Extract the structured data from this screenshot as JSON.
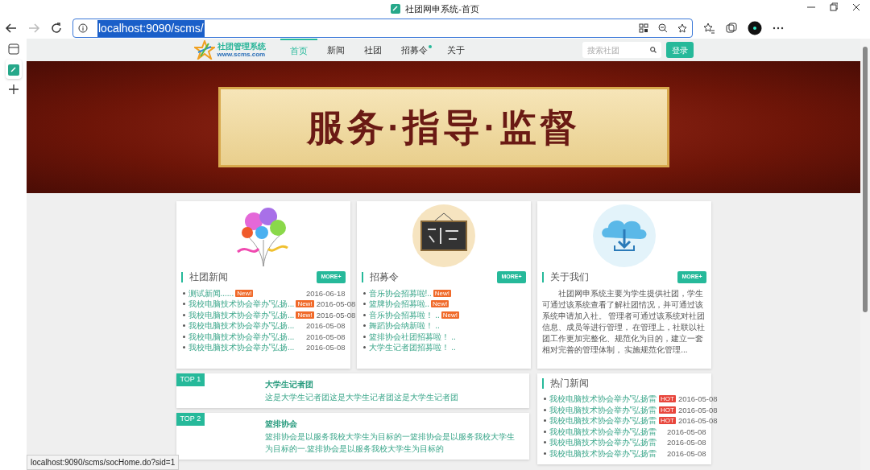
{
  "browser": {
    "tab_title": "社团网申系统-首页",
    "url": "localhost:9090/scms/",
    "status_url": "localhost:9090/scms/socHome.do?sid=1"
  },
  "site": {
    "logo_title": "社团管理系统",
    "logo_subtitle": "www.scms.com",
    "nav": [
      {
        "label": "首页",
        "selected": true,
        "dot": false
      },
      {
        "label": "新闻",
        "selected": false,
        "dot": false
      },
      {
        "label": "社团",
        "selected": false,
        "dot": false
      },
      {
        "label": "招募令",
        "selected": false,
        "dot": true
      },
      {
        "label": "关于",
        "selected": false,
        "dot": false
      }
    ],
    "search": {
      "placeholder": "搜索社团"
    },
    "login": "登录"
  },
  "banner": {
    "title": "服务·指导·监督"
  },
  "panels": [
    {
      "kind": "news",
      "title": "社团新闻",
      "more": "MORE+",
      "items": [
        {
          "text": "测试新闻......",
          "badge": "New!",
          "date": "2016-06-18"
        },
        {
          "text": "我校电脑技术协会举办\"弘扬...",
          "badge": "New!",
          "date": "2016-05-08"
        },
        {
          "text": "我校电脑技术协会举办\"弘扬...",
          "badge": "New!",
          "date": "2016-05-08"
        },
        {
          "text": "我校电脑技术协会举办\"弘扬...",
          "date": "2016-05-08"
        },
        {
          "text": "我校电脑技术协会举办\"弘扬...",
          "date": "2016-05-08"
        },
        {
          "text": "我校电脑技术协会举办\"弘扬...",
          "date": "2016-05-08"
        }
      ]
    },
    {
      "kind": "recruit",
      "title": "招募令",
      "more": "MORE+",
      "items": [
        {
          "text": "音乐协会招募啦!..",
          "badge": "New!"
        },
        {
          "text": "篮牌协会招募啦..",
          "badge": "New!"
        },
        {
          "text": "音乐协会招募啦！ ..",
          "badge": "New!"
        },
        {
          "text": "舞蹈协会纳新啦！ .."
        },
        {
          "text": "篮排协会社团招募啦！ .."
        },
        {
          "text": "大学生记者团招募啦！ .."
        }
      ]
    },
    {
      "kind": "about",
      "title": "关于我们",
      "more": "MORE+",
      "text": "社团网申系统主要为学生提供社团，学生可通过该系统查看了解社团情况，并可通过该系统申请加入社。 管理者可通过该系统对社团信息、成员等进行管理， 在管理上，社联以社团工作更加完整化、规范化为目的，建立一套相对完善的管理体制， 实施规范化管理..."
    }
  ],
  "top_clubs": [
    {
      "rank": "TOP 1",
      "name": "大学生记者团",
      "desc": "这是大学生记者团这是大学生记者团这是大学生记者团"
    },
    {
      "rank": "TOP 2",
      "name": "篮排协会",
      "desc": "篮排协会是以服务我校大学生为目标的一篮排协会是以服务我校大学生为目标的一.篮排协会是以服务我校大学生为目标的"
    }
  ],
  "hot_news": {
    "title": "热门新闻",
    "items": [
      {
        "text": "我校电脑技术协会举办\"弘扬雷",
        "badge": "HOT",
        "date": "2016-05-08"
      },
      {
        "text": "我校电脑技术协会举办\"弘扬雷",
        "badge": "HOT",
        "date": "2016-05-08"
      },
      {
        "text": "我校电脑技术协会举办\"弘扬雷",
        "badge": "HOT",
        "date": "2016-05-08"
      },
      {
        "text": "我校电脑技术协会举办\"弘扬雷",
        "date": "2016-05-08"
      },
      {
        "text": "我校电脑技术协会举办\"弘扬雷",
        "date": "2016-05-08"
      },
      {
        "text": "我校电脑技术协会举办\"弘扬雷",
        "date": "2016-05-08"
      }
    ]
  }
}
